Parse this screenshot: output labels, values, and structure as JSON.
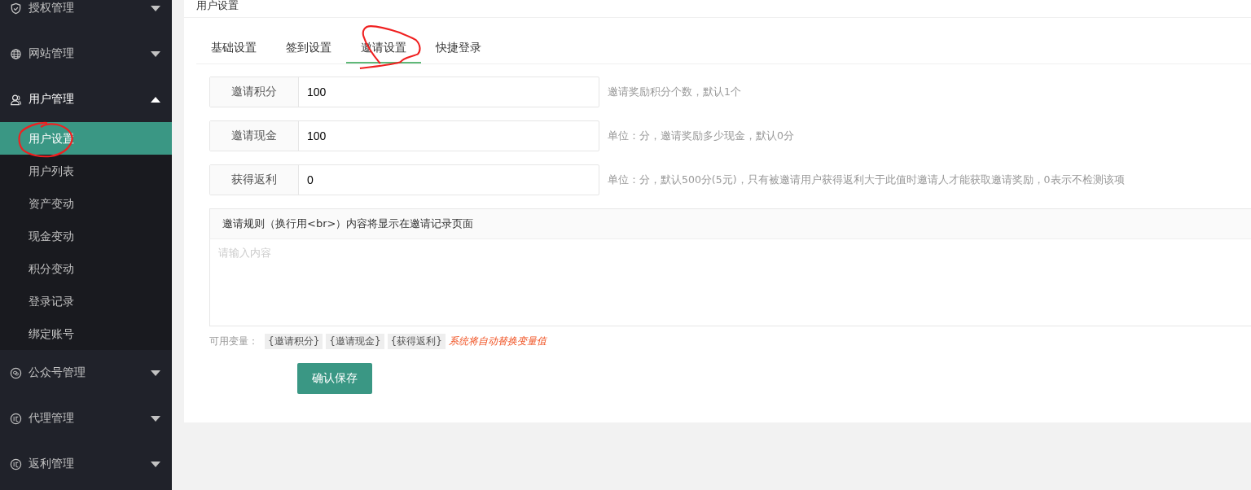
{
  "sidebar": {
    "items": [
      {
        "label": "授权管理",
        "expanded": false
      },
      {
        "label": "网站管理",
        "expanded": false
      },
      {
        "label": "用户管理",
        "expanded": true,
        "children": [
          {
            "label": "用户设置",
            "selected": true
          },
          {
            "label": "用户列表",
            "selected": false
          },
          {
            "label": "资产变动",
            "selected": false
          },
          {
            "label": "现金变动",
            "selected": false
          },
          {
            "label": "积分变动",
            "selected": false
          },
          {
            "label": "登录记录",
            "selected": false
          },
          {
            "label": "绑定账号",
            "selected": false
          }
        ]
      },
      {
        "label": "公众号管理",
        "expanded": false
      },
      {
        "label": "代理管理",
        "expanded": false
      },
      {
        "label": "返利管理",
        "expanded": false
      }
    ]
  },
  "card": {
    "title": "用户设置",
    "tabs": [
      {
        "label": "基础设置",
        "selected": false
      },
      {
        "label": "签到设置",
        "selected": false
      },
      {
        "label": "邀请设置",
        "selected": true
      },
      {
        "label": "快捷登录",
        "selected": false
      }
    ],
    "fields": [
      {
        "label": "邀请积分",
        "value": "100",
        "hint": "邀请奖励积分个数，默认1个"
      },
      {
        "label": "邀请现金",
        "value": "100",
        "hint": "单位：分，邀请奖励多少现金，默认0分"
      },
      {
        "label": "获得返利",
        "value": "0",
        "hint": "单位：分，默认500分(5元)，只有被邀请用户获得返利大于此值时邀请人才能获取邀请奖励，0表示不检测该项"
      }
    ],
    "rules": {
      "label": "邀请规则（换行用<br>）内容将显示在邀请记录页面",
      "placeholder": "请输入内容"
    },
    "variables": {
      "label": "可用变量：",
      "tags": [
        "{邀请积分}",
        "{邀请现金}",
        "{获得返利}"
      ],
      "note": "系统将自动替换变量值"
    },
    "save_button": "确认保存"
  }
}
